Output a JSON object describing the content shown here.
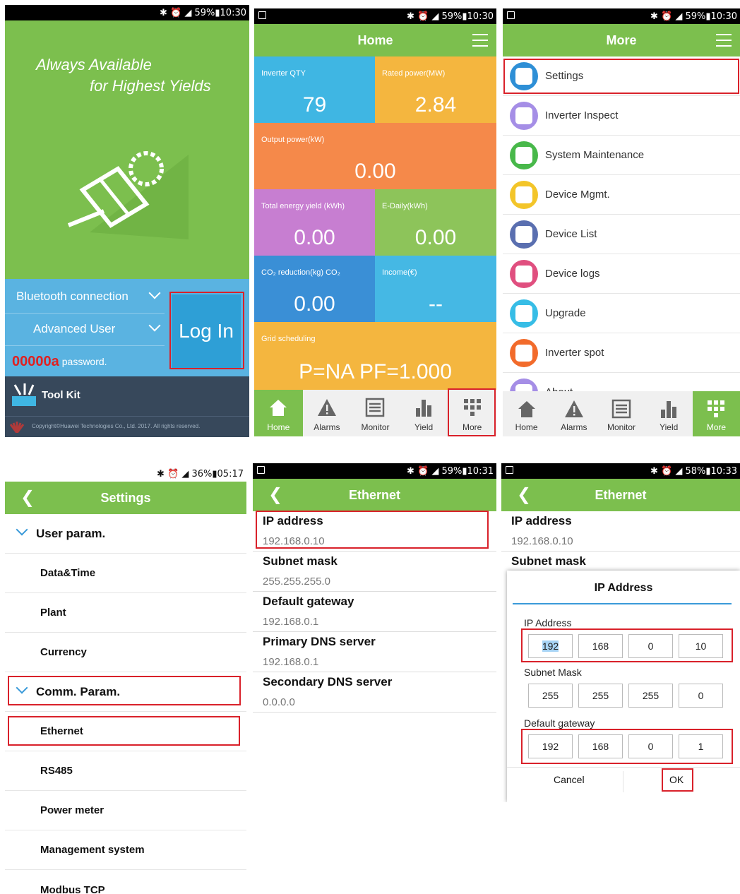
{
  "colors": {
    "green": "#7cbf4e",
    "blue": "#5ab3e1",
    "red_highlight": "#d9212a",
    "dark": "#37485b"
  },
  "login": {
    "status": "59%▮10:30",
    "slogan_line1": "Always Available",
    "slogan_line2": "for Highest Yields",
    "connection": "Bluetooth connection",
    "user": "Advanced User",
    "password_placeholder": "password.",
    "password_value": "00000a",
    "login_button": "Log In",
    "toolkit": "Tool Kit",
    "copyright": "Copyright©Huawei Technologies Co., Ltd. 2017. All rights reserved."
  },
  "home": {
    "status": "59%▮10:30",
    "title": "Home",
    "tiles": [
      {
        "label": "Inverter QTY",
        "value": "79",
        "color": "#3fb6e3"
      },
      {
        "label": "Rated power(MW)",
        "value": "2.84",
        "color": "#f4b63f"
      },
      {
        "label": "Output power(kW)",
        "value": "0.00",
        "color": "#f5894a"
      },
      {
        "label": "Total energy yield  (kWh)",
        "value": "0.00",
        "color": "#c77ed1"
      },
      {
        "label": "E-Daily(kWh)",
        "value": "0.00",
        "color": "#8dc45a"
      },
      {
        "label": "CO₂ reduction(kg) CO₂",
        "value": "0.00",
        "color": "#3a8fd6"
      },
      {
        "label": "Income(€)",
        "value": "--",
        "color": "#45b8e4"
      },
      {
        "label": "Grid scheduling",
        "value": "P=NA PF=1.000",
        "color": "#f4b63f"
      }
    ],
    "tabs": [
      "Home",
      "Alarms",
      "Monitor",
      "Yield",
      "More"
    ]
  },
  "more": {
    "status": "59%▮10:30",
    "title": "More",
    "items": [
      {
        "label": "Settings",
        "icon": "settings-gear-icon",
        "color": "#2e8fd6"
      },
      {
        "label": "Inverter Inspect",
        "icon": "inspect-icon",
        "color": "#a58ee6"
      },
      {
        "label": "System Maintenance",
        "icon": "wrench-icon",
        "color": "#48b84a"
      },
      {
        "label": "Device Mgmt.",
        "icon": "device-mgmt-icon",
        "color": "#f3c529"
      },
      {
        "label": "Device List",
        "icon": "device-list-icon",
        "color": "#5a6fb0"
      },
      {
        "label": "Device logs",
        "icon": "device-logs-icon",
        "color": "#e04f7f"
      },
      {
        "label": "Upgrade",
        "icon": "upgrade-arrow-icon",
        "color": "#37bde6"
      },
      {
        "label": "Inverter spot",
        "icon": "inverter-spot-icon",
        "color": "#f26b2b"
      },
      {
        "label": "About",
        "icon": "about-icon",
        "color": "#a58ee6"
      }
    ],
    "tabs": [
      "Home",
      "Alarms",
      "Monitor",
      "Yield",
      "More"
    ]
  },
  "settings": {
    "status": "36%▮05:17",
    "title": "Settings",
    "group1": "User param.",
    "group1_items": [
      "Data&Time",
      "Plant",
      "Currency"
    ],
    "group2": "Comm. Param.",
    "group2_items": [
      "Ethernet",
      "RS485",
      "Power meter",
      "Management system",
      "Modbus TCP"
    ]
  },
  "ethernet": {
    "status": "59%▮10:31",
    "title": "Ethernet",
    "rows": [
      {
        "label": "IP address",
        "value": "192.168.0.10"
      },
      {
        "label": "Subnet mask",
        "value": "255.255.255.0"
      },
      {
        "label": "Default gateway",
        "value": "192.168.0.1"
      },
      {
        "label": "Primary DNS server",
        "value": "192.168.0.1"
      },
      {
        "label": "Secondary DNS server",
        "value": "0.0.0.0"
      }
    ]
  },
  "dialog": {
    "status": "58%▮10:33",
    "title": "Ethernet",
    "bg_rows": [
      {
        "label": "IP address",
        "value": "192.168.0.10"
      },
      {
        "label": "Subnet mask"
      }
    ],
    "dialog_title": "IP Address",
    "ip_label": "IP Address",
    "ip": [
      "192",
      "168",
      "0",
      "10"
    ],
    "mask_label": "Subnet Mask",
    "mask": [
      "255",
      "255",
      "255",
      "0"
    ],
    "gw_label": "Default gateway",
    "gw": [
      "192",
      "168",
      "0",
      "1"
    ],
    "cancel": "Cancel",
    "ok": "OK"
  }
}
